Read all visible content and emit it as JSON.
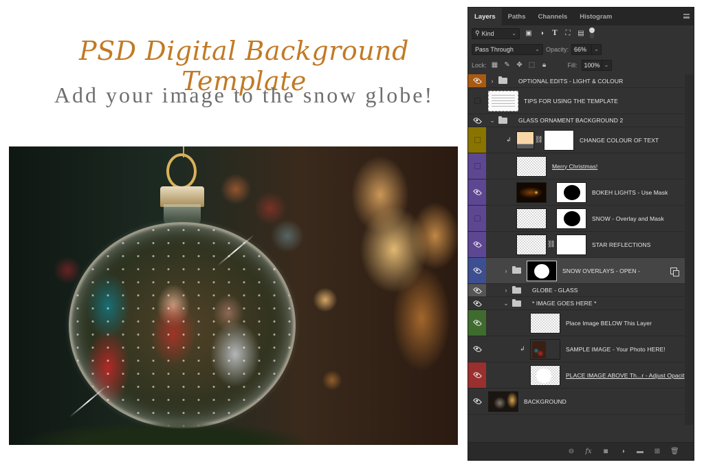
{
  "promo": {
    "title": "PSD Digital Background Template",
    "subtitle": "Add your image to the snow globe!",
    "title_color": "#c27a25",
    "subtitle_color": "#6f6f6f"
  },
  "panel": {
    "tabs": [
      {
        "label": "Layers",
        "active": true
      },
      {
        "label": "Paths",
        "active": false
      },
      {
        "label": "Channels",
        "active": false
      },
      {
        "label": "Histogram",
        "active": false
      }
    ],
    "filter": {
      "kind_label": "Kind",
      "icons": [
        "pixel-filter-icon",
        "adjustment-filter-icon",
        "type-filter-icon",
        "shape-filter-icon",
        "smart-object-filter-icon",
        "filter-toggle"
      ]
    },
    "blend_mode": "Pass Through",
    "opacity_label": "Opacity:",
    "opacity_value": "66%",
    "lock_label": "Lock:",
    "fill_label": "Fill:",
    "fill_value": "100%",
    "layers": [
      {
        "name": "OPTIONAL EDITS - LIGHT & COLOUR",
        "type": "group",
        "expanded": false,
        "visible": true,
        "color_tag": "#a85a12",
        "indent": 0
      },
      {
        "name": "TIPS FOR USING THE TEMPLATE",
        "type": "layer",
        "visible": false,
        "color_tag": null,
        "indent": 0,
        "thumb": "tips"
      },
      {
        "name": "GLASS ORNAMENT BACKGROUND 2",
        "type": "group",
        "expanded": true,
        "visible": true,
        "color_tag": null,
        "indent": 0
      },
      {
        "name": "CHANGE COLOUR OF TEXT",
        "type": "adjustment",
        "visible": false,
        "color_tag": "#8a7400",
        "indent": 1,
        "clipped": true,
        "thumb": "color-fill",
        "mask": "white",
        "linked": true
      },
      {
        "name": "Merry Christmas!",
        "type": "text",
        "visible": false,
        "color_tag": "#5d4793",
        "indent": 1,
        "thumb": "checker",
        "underline": true
      },
      {
        "name": "BOKEH LIGHTS - Use Mask",
        "type": "layer",
        "visible": true,
        "color_tag": "#5d4793",
        "indent": 1,
        "thumb": "bokeh",
        "mask": "black-circle"
      },
      {
        "name": "SNOW - Overlay and Mask",
        "type": "layer",
        "visible": false,
        "color_tag": "#5d4793",
        "indent": 1,
        "thumb": "checker",
        "mask": "black-circle"
      },
      {
        "name": "STAR REFLECTIONS",
        "type": "layer",
        "visible": true,
        "color_tag": "#5d4793",
        "indent": 1,
        "thumb": "checker",
        "mask": "white",
        "linked": true
      },
      {
        "name": "SNOW OVERLAYS - OPEN -",
        "type": "group",
        "expanded": false,
        "visible": true,
        "color_tag": "#3d4f91",
        "indent": 1,
        "mask": "white-circle",
        "selected": true,
        "smart_filter": true
      },
      {
        "name": "GLOBE - GLASS",
        "type": "group",
        "expanded": false,
        "visible": true,
        "color_tag": "#555555",
        "indent": 1
      },
      {
        "name": "* IMAGE GOES HERE *",
        "type": "group",
        "expanded": true,
        "visible": true,
        "color_tag": null,
        "indent": 1
      },
      {
        "name": "Place Image BELOW This Layer",
        "type": "layer",
        "visible": true,
        "color_tag": "#3f6b2f",
        "indent": 2,
        "thumb": "checker"
      },
      {
        "name": "SAMPLE IMAGE - Your Photo HERE!",
        "type": "layer",
        "visible": true,
        "color_tag": null,
        "indent": 2,
        "clipped": true,
        "thumb": "sample"
      },
      {
        "name": "PLACE IMAGE ABOVE Th...r - Adjust Opacity",
        "type": "layer",
        "visible": true,
        "color_tag": "#9a2f2f",
        "indent": 2,
        "thumb": "checker-white-circle",
        "underline": true
      },
      {
        "name": "BACKGROUND",
        "type": "layer",
        "visible": true,
        "color_tag": null,
        "indent": 0,
        "thumb": "bg-photo"
      }
    ],
    "footer_icons": [
      "link-layers-icon",
      "fx-icon",
      "add-mask-icon",
      "adjustment-layer-icon",
      "new-group-icon",
      "new-layer-icon",
      "delete-icon"
    ]
  }
}
